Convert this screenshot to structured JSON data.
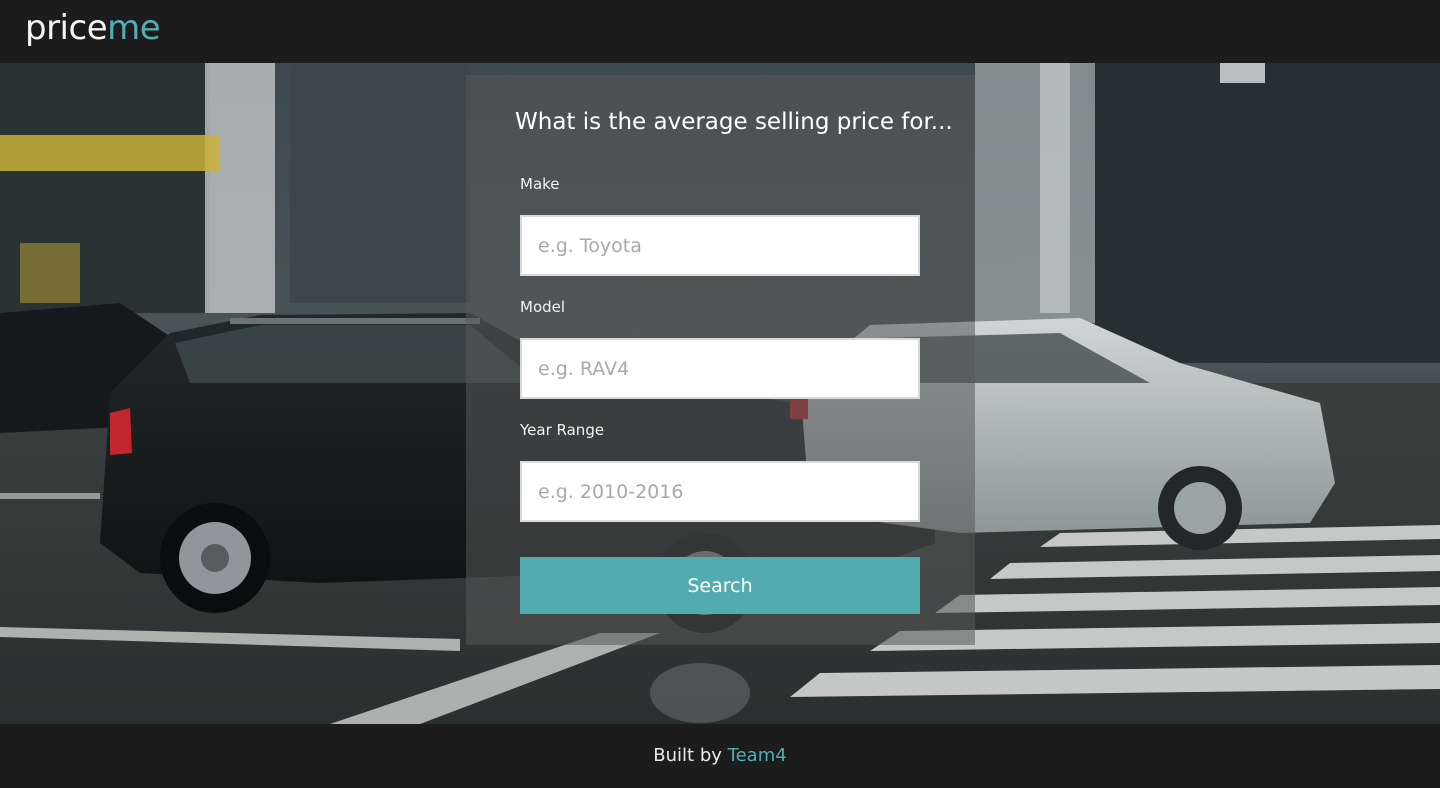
{
  "header": {
    "logo_part1": "price",
    "logo_part2": "me"
  },
  "form": {
    "title": "What is the average selling price for...",
    "make": {
      "label": "Make",
      "placeholder": "e.g. Toyota",
      "value": ""
    },
    "model": {
      "label": "Model",
      "placeholder": "e.g. RAV4",
      "value": ""
    },
    "year_range": {
      "label": "Year Range",
      "placeholder": "e.g. 2010-2016",
      "value": ""
    },
    "search_label": "Search"
  },
  "footer": {
    "prefix": "Built by",
    "link_text": "Team4"
  },
  "colors": {
    "bar_background": "#1c1c1c",
    "accent": "#52aeb2",
    "button": "#52abae"
  },
  "background_image": "city street with a black SUV and a silver hatchback passing a crosswalk, motion blurred"
}
